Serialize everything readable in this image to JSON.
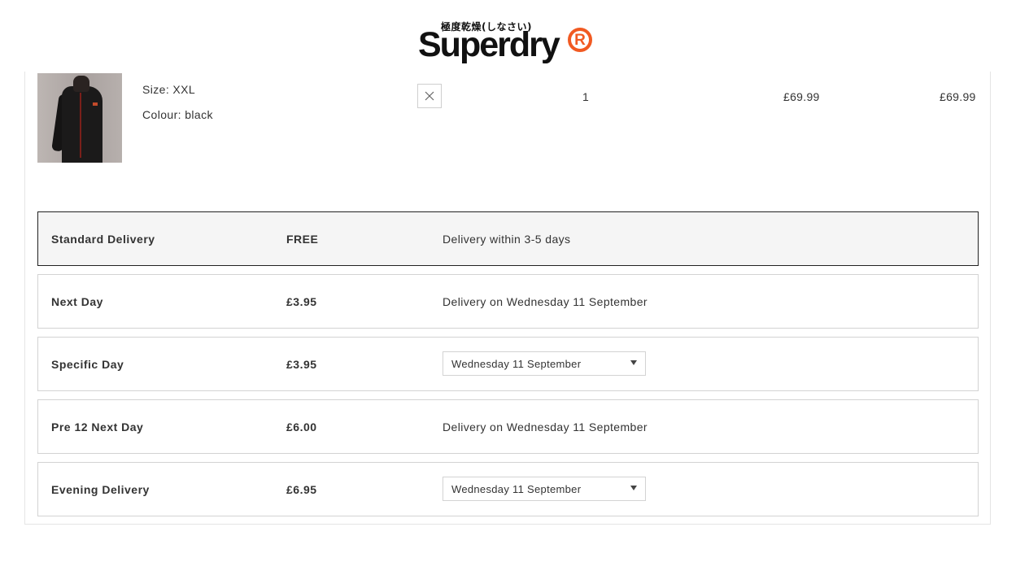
{
  "brand": {
    "name": "Superdry",
    "tagline_jp": "極度乾燥(しなさい)",
    "registered_mark": "R",
    "accent_color": "#f15a22"
  },
  "basket_item": {
    "size": "Size: XXL",
    "colour": "Colour: black",
    "quantity": "1",
    "unit_price": "£69.99",
    "total_price": "£69.99",
    "remove_icon": "close-icon"
  },
  "delivery_options": [
    {
      "name": "Standard Delivery",
      "price": "FREE",
      "description": "Delivery within 3-5 days",
      "selected": true
    },
    {
      "name": "Next Day",
      "price": "£3.95",
      "description": "Delivery on Wednesday 11 September",
      "selected": false
    },
    {
      "name": "Specific Day",
      "price": "£3.95",
      "select_value": "Wednesday 11 September",
      "selected": false
    },
    {
      "name": "Pre 12 Next Day",
      "price": "£6.00",
      "description": "Delivery on Wednesday 11 September",
      "selected": false
    },
    {
      "name": "Evening Delivery",
      "price": "£6.95",
      "select_value": "Wednesday 11 September",
      "selected": false
    }
  ]
}
